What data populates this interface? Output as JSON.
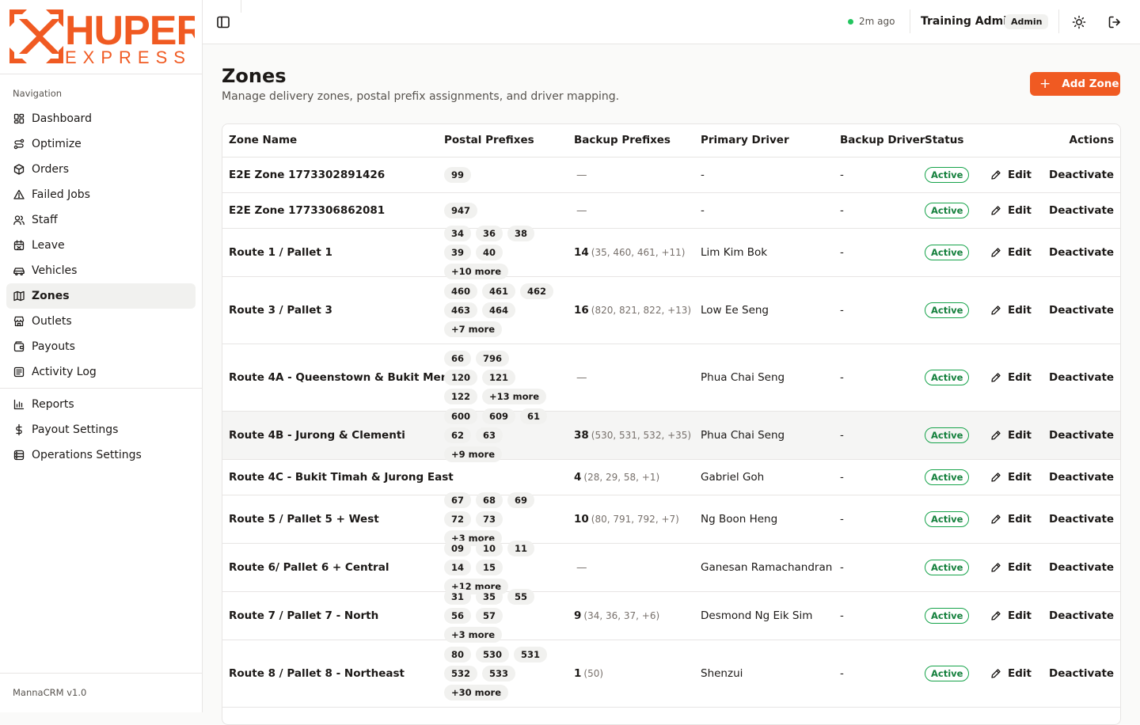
{
  "brand": {
    "logo_text": "HUPER",
    "logo_sub": "EXPRESS",
    "accent": "#f05a22"
  },
  "sidebar": {
    "heading": "Navigation",
    "items": [
      {
        "label": "Dashboard",
        "icon": "dashboard-icon"
      },
      {
        "label": "Optimize",
        "icon": "route-icon"
      },
      {
        "label": "Orders",
        "icon": "package-icon"
      },
      {
        "label": "Failed Jobs",
        "icon": "warning-icon"
      },
      {
        "label": "Staff",
        "icon": "users-icon"
      },
      {
        "label": "Leave",
        "icon": "calendar-icon"
      },
      {
        "label": "Vehicles",
        "icon": "car-icon"
      },
      {
        "label": "Zones",
        "icon": "map-icon",
        "active": true
      },
      {
        "label": "Outlets",
        "icon": "store-icon"
      },
      {
        "label": "Payouts",
        "icon": "wallet-icon"
      },
      {
        "label": "Activity Log",
        "icon": "log-icon"
      }
    ],
    "items2": [
      {
        "label": "Reports",
        "icon": "chart-icon"
      },
      {
        "label": "Payout Settings",
        "icon": "dollar-icon"
      },
      {
        "label": "Operations Settings",
        "icon": "settings-db-icon"
      }
    ],
    "version": "MannaCRM v1.0"
  },
  "topbar": {
    "sync_text": "2m ago",
    "user_name": "Training Admin",
    "role": "Admin"
  },
  "page": {
    "title": "Zones",
    "subtitle": "Manage delivery zones, postal prefix assignments, and driver mapping.",
    "add_button": "Add Zone"
  },
  "table": {
    "headers": [
      "Zone Name",
      "Postal Prefixes",
      "Backup Prefixes",
      "Primary Driver",
      "Backup Driver",
      "Status",
      "Actions"
    ],
    "edit_label": "Edit",
    "deactivate_label": "Deactivate",
    "rows": [
      {
        "name": "E2E Zone 1773302891426",
        "prefixes": [
          "99"
        ],
        "backup_count": "",
        "backup_list": "",
        "backup_dash": "—",
        "primary": "-",
        "backup_driver": "-",
        "status": "Active"
      },
      {
        "name": "E2E Zone 1773306862081",
        "prefixes": [
          "947"
        ],
        "backup_count": "",
        "backup_list": "",
        "backup_dash": "—",
        "primary": "-",
        "backup_driver": "-",
        "status": "Active"
      },
      {
        "name": "Route 1 / Pallet 1",
        "prefixes": [
          "34",
          "36",
          "38",
          "39",
          "40",
          "+10 more"
        ],
        "backup_count": "14",
        "backup_list": "(35, 460, 461, +11)",
        "backup_dash": "",
        "primary": "Lim Kim Bok",
        "backup_driver": "-",
        "status": "Active"
      },
      {
        "name": "Route 3 / Pallet 3",
        "prefixes": [
          "460",
          "461",
          "462",
          "463",
          "464",
          "+7 more"
        ],
        "backup_count": "16",
        "backup_list": "(820, 821, 822, +13)",
        "backup_dash": "",
        "primary": "Low Ee Seng",
        "backup_driver": "-",
        "status": "Active"
      },
      {
        "name": "Route 4A - Queenstown & Bukit Merah",
        "prefixes": [
          "66",
          "796",
          "120",
          "121",
          "122",
          "+13 more"
        ],
        "backup_count": "",
        "backup_list": "",
        "backup_dash": "—",
        "primary": "Phua Chai Seng",
        "backup_driver": "-",
        "status": "Active"
      },
      {
        "name": "Route 4B - Jurong & Clementi",
        "prefixes": [
          "600",
          "609",
          "61",
          "62",
          "63",
          "+9 more"
        ],
        "backup_count": "38",
        "backup_list": "(530, 531, 532, +35)",
        "backup_dash": "",
        "primary": "Phua Chai Seng",
        "backup_driver": "-",
        "status": "Active"
      },
      {
        "name": "Route 4C - Bukit Timah & Jurong East",
        "prefixes": [],
        "backup_count": "4",
        "backup_list": "(28, 29, 58, +1)",
        "backup_dash": "",
        "primary": "Gabriel Goh",
        "backup_driver": "-",
        "status": "Active"
      },
      {
        "name": "Route 5 / Pallet 5 + West",
        "prefixes": [
          "67",
          "68",
          "69",
          "72",
          "73",
          "+3 more"
        ],
        "backup_count": "10",
        "backup_list": "(80, 791, 792, +7)",
        "backup_dash": "",
        "primary": "Ng Boon Heng",
        "backup_driver": "-",
        "status": "Active"
      },
      {
        "name": "Route 6/ Pallet 6 + Central",
        "prefixes": [
          "09",
          "10",
          "11",
          "14",
          "15",
          "+12 more"
        ],
        "backup_count": "",
        "backup_list": "",
        "backup_dash": "—",
        "primary": "Ganesan Ramachandran",
        "backup_driver": "-",
        "status": "Active"
      },
      {
        "name": "Route 7 / Pallet 7 - North",
        "prefixes": [
          "31",
          "35",
          "55",
          "56",
          "57",
          "+3 more"
        ],
        "backup_count": "9",
        "backup_list": "(34, 36, 37, +6)",
        "backup_dash": "",
        "primary": "Desmond Ng Eik Sim",
        "backup_driver": "-",
        "status": "Active"
      },
      {
        "name": "Route 8 / Pallet 8 - Northeast",
        "prefixes": [
          "80",
          "530",
          "531",
          "532",
          "533",
          "+30 more"
        ],
        "backup_count": "1",
        "backup_list": "(50)",
        "backup_dash": "",
        "primary": "Shenzui",
        "backup_driver": "-",
        "status": "Active"
      }
    ]
  }
}
